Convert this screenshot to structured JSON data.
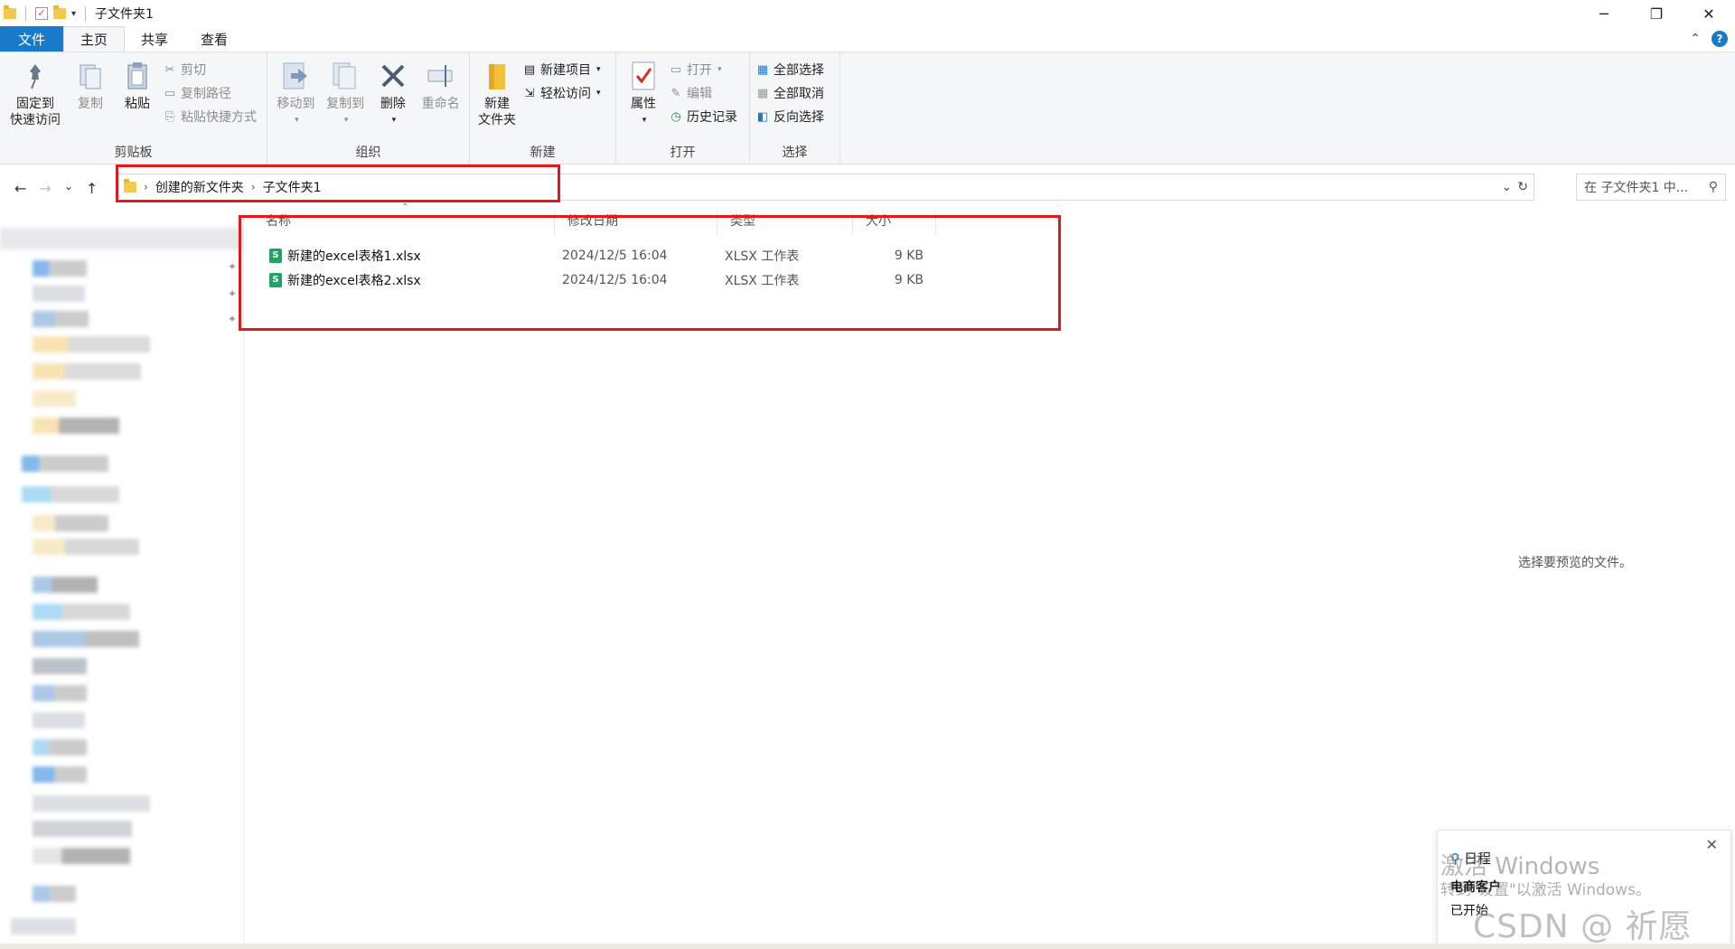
{
  "window": {
    "title": "子文件夹1",
    "controls": {
      "minimize": "─",
      "restore": "❐",
      "close": "✕"
    }
  },
  "tabs": [
    "文件",
    "主页",
    "共享",
    "查看"
  ],
  "ribbon": {
    "clipboard": {
      "label": "剪贴板",
      "pin": "固定到",
      "pin2": "快速访问",
      "copy": "复制",
      "paste": "粘贴",
      "cut": "剪切",
      "copy_path": "复制路径",
      "paste_shortcut": "粘贴快捷方式"
    },
    "organize": {
      "label": "组织",
      "move_to": "移动到",
      "copy_to": "复制到",
      "delete": "删除",
      "rename": "重命名"
    },
    "new": {
      "label": "新建",
      "new_folder": "新建",
      "new_folder2": "文件夹",
      "new_item": "新建项目",
      "easy_access": "轻松访问"
    },
    "open": {
      "label": "打开",
      "properties": "属性",
      "open": "打开",
      "edit": "编辑",
      "history": "历史记录"
    },
    "select": {
      "label": "选择",
      "select_all": "全部选择",
      "select_none": "全部取消",
      "invert": "反向选择"
    }
  },
  "address": {
    "crumbs": [
      "创建的新文件夹",
      "子文件夹1"
    ],
    "search_placeholder": "在 子文件夹1 中..."
  },
  "columns": [
    "名称",
    "修改日期",
    "类型",
    "大小"
  ],
  "files": [
    {
      "name": "新建的excel表格1.xlsx",
      "date": "2024/12/5 16:04",
      "type": "XLSX 工作表",
      "size": "9 KB",
      "icon": "S"
    },
    {
      "name": "新建的excel表格2.xlsx",
      "date": "2024/12/5 16:04",
      "type": "XLSX 工作表",
      "size": "9 KB",
      "icon": "S"
    }
  ],
  "preview_message": "选择要预览的文件。",
  "toast": {
    "line1": "日程",
    "line2": "电商客户",
    "line3": "已开始"
  },
  "watermark": {
    "activate_title": "激活 Windows",
    "activate_sub": "转到\"设置\"以激活 Windows。",
    "csdn": "CSDN @ 祈愿"
  },
  "colors": {
    "file_tab": "#1979ca",
    "highlight": "#e2191b",
    "excel_icon": "#1fa463"
  }
}
